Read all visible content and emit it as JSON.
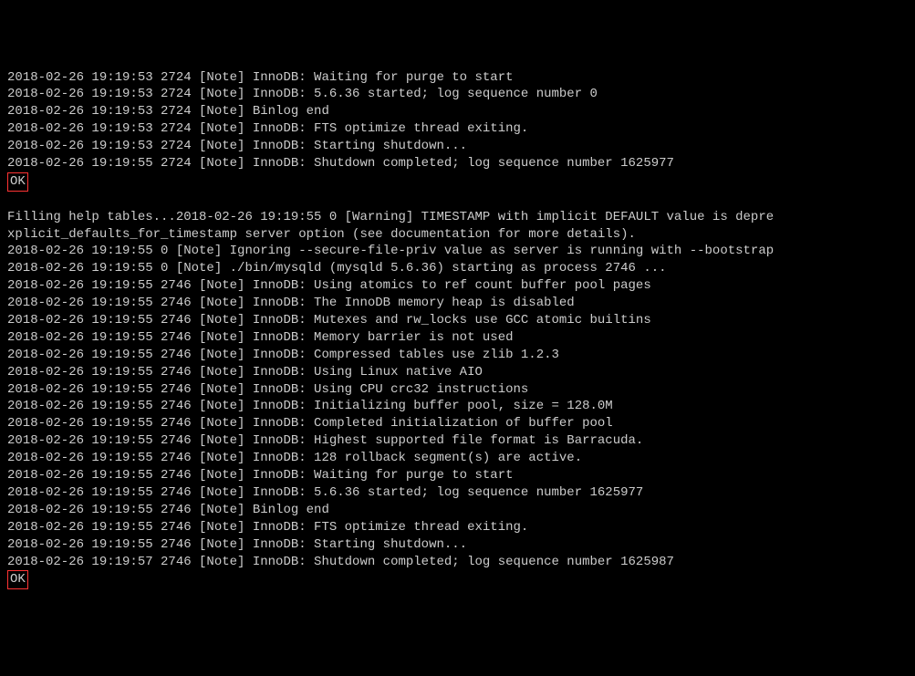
{
  "lines": [
    "2018-02-26 19:19:53 2724 [Note] InnoDB: Waiting for purge to start",
    "2018-02-26 19:19:53 2724 [Note] InnoDB: 5.6.36 started; log sequence number 0",
    "2018-02-26 19:19:53 2724 [Note] Binlog end",
    "2018-02-26 19:19:53 2724 [Note] InnoDB: FTS optimize thread exiting.",
    "2018-02-26 19:19:53 2724 [Note] InnoDB: Starting shutdown...",
    "2018-02-26 19:19:55 2724 [Note] InnoDB: Shutdown completed; log sequence number 1625977"
  ],
  "ok1": "OK",
  "blank1": "",
  "lines2": [
    "Filling help tables...2018-02-26 19:19:55 0 [Warning] TIMESTAMP with implicit DEFAULT value is depre",
    "xplicit_defaults_for_timestamp server option (see documentation for more details).",
    "2018-02-26 19:19:55 0 [Note] Ignoring --secure-file-priv value as server is running with --bootstrap",
    "2018-02-26 19:19:55 0 [Note] ./bin/mysqld (mysqld 5.6.36) starting as process 2746 ...",
    "2018-02-26 19:19:55 2746 [Note] InnoDB: Using atomics to ref count buffer pool pages",
    "2018-02-26 19:19:55 2746 [Note] InnoDB: The InnoDB memory heap is disabled",
    "2018-02-26 19:19:55 2746 [Note] InnoDB: Mutexes and rw_locks use GCC atomic builtins",
    "2018-02-26 19:19:55 2746 [Note] InnoDB: Memory barrier is not used",
    "2018-02-26 19:19:55 2746 [Note] InnoDB: Compressed tables use zlib 1.2.3",
    "2018-02-26 19:19:55 2746 [Note] InnoDB: Using Linux native AIO",
    "2018-02-26 19:19:55 2746 [Note] InnoDB: Using CPU crc32 instructions",
    "2018-02-26 19:19:55 2746 [Note] InnoDB: Initializing buffer pool, size = 128.0M",
    "2018-02-26 19:19:55 2746 [Note] InnoDB: Completed initialization of buffer pool",
    "2018-02-26 19:19:55 2746 [Note] InnoDB: Highest supported file format is Barracuda.",
    "2018-02-26 19:19:55 2746 [Note] InnoDB: 128 rollback segment(s) are active.",
    "2018-02-26 19:19:55 2746 [Note] InnoDB: Waiting for purge to start",
    "2018-02-26 19:19:55 2746 [Note] InnoDB: 5.6.36 started; log sequence number 1625977",
    "2018-02-26 19:19:55 2746 [Note] Binlog end",
    "2018-02-26 19:19:55 2746 [Note] InnoDB: FTS optimize thread exiting.",
    "2018-02-26 19:19:55 2746 [Note] InnoDB: Starting shutdown...",
    "2018-02-26 19:19:57 2746 [Note] InnoDB: Shutdown completed; log sequence number 1625987"
  ],
  "ok2": "OK"
}
